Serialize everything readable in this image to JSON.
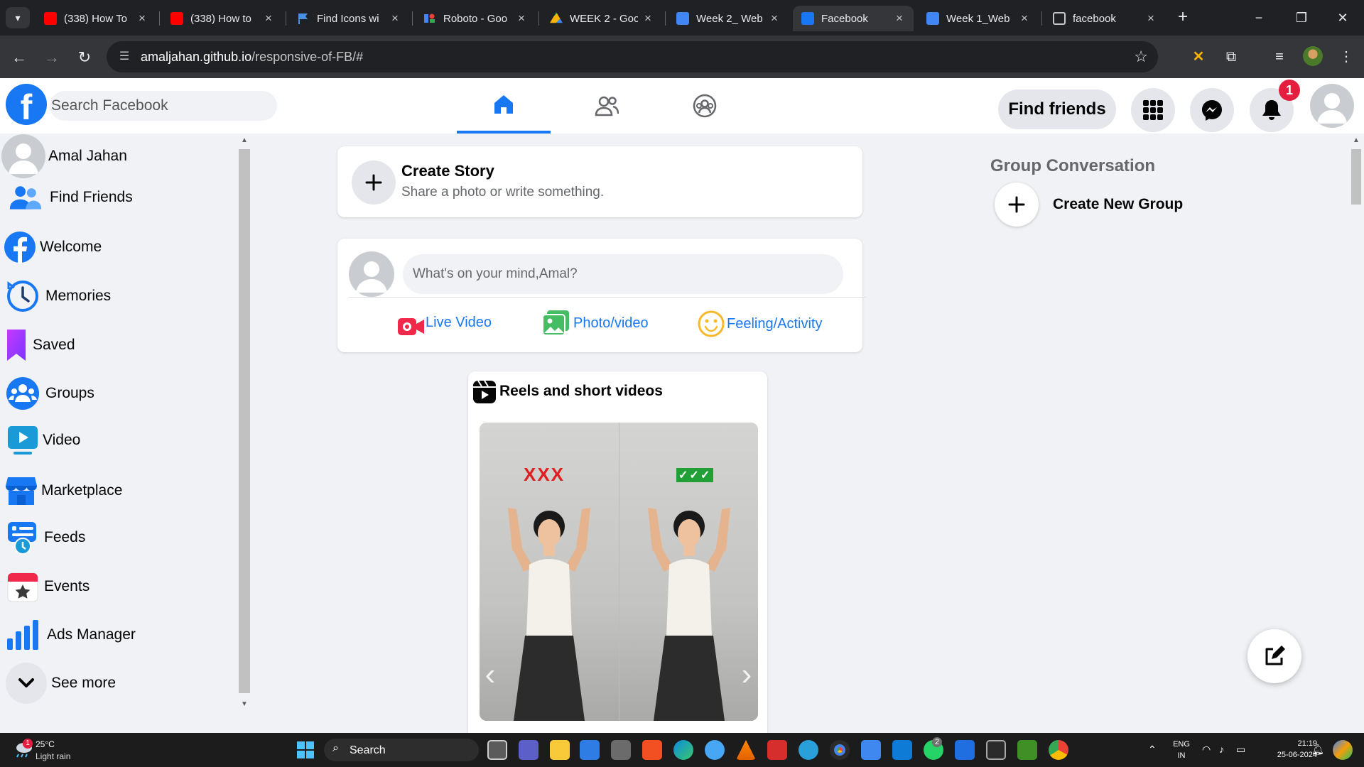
{
  "browser": {
    "tabs": [
      {
        "title": "(338) How To",
        "favicon": "youtube-icon"
      },
      {
        "title": "(338) How to",
        "favicon": "youtube-icon"
      },
      {
        "title": "Find Icons wi",
        "favicon": "flag-icon"
      },
      {
        "title": "Roboto - Goo",
        "favicon": "google-fonts-icon"
      },
      {
        "title": "WEEK 2 - Goo",
        "favicon": "google-drive-icon"
      },
      {
        "title": "Week 2_ Web",
        "favicon": "google-docs-icon"
      },
      {
        "title": "Facebook",
        "favicon": "facebook-icon",
        "active": true
      },
      {
        "title": "Week 1_Web",
        "favicon": "google-docs-icon"
      },
      {
        "title": "facebook",
        "favicon": "globe-icon"
      }
    ],
    "url_host": "amaljahan.github.io",
    "url_path": "/responsive-of-FB/#"
  },
  "header": {
    "logo_letter": "f",
    "search_placeholder": "Search Facebook",
    "find_friends_label": "Find friends",
    "notification_count": "1",
    "accent_color": "#1877f2"
  },
  "sidebar": {
    "items": [
      {
        "label": "Amal Jahan",
        "icon": "user-avatar-icon"
      },
      {
        "label": "Find Friends",
        "icon": "friends-icon"
      },
      {
        "label": "Welcome",
        "icon": "facebook-icon"
      },
      {
        "label": "Memories",
        "icon": "clock-icon"
      },
      {
        "label": "Saved",
        "icon": "bookmark-icon"
      },
      {
        "label": "Groups",
        "icon": "groups-icon"
      },
      {
        "label": "Video",
        "icon": "video-icon"
      },
      {
        "label": "Marketplace",
        "icon": "shop-icon"
      },
      {
        "label": "Feeds",
        "icon": "feeds-icon"
      },
      {
        "label": "Events",
        "icon": "calendar-icon"
      },
      {
        "label": "Ads Manager",
        "icon": "bar-chart-icon"
      },
      {
        "label": "See more",
        "icon": "chevron-down-icon"
      }
    ]
  },
  "story": {
    "title": "Create Story",
    "subtitle": "Share a photo or write something."
  },
  "composer": {
    "placeholder": "What's on your mind,Amal?",
    "actions": [
      {
        "label": "Live Video",
        "icon": "live-video-icon"
      },
      {
        "label": "Photo/video",
        "icon": "photo-icon"
      },
      {
        "label": "Feeling/Activity",
        "icon": "smiley-icon"
      }
    ]
  },
  "reels": {
    "title": "Reels and short videos",
    "left_marks": "XXX",
    "right_marks": "✓✓✓"
  },
  "right_column": {
    "heading": "Group Conversation",
    "create_group_label": "Create New Group"
  },
  "taskbar": {
    "weather_temp": "25°C",
    "weather_condition": "Light rain",
    "weather_badge": "1",
    "search_label": "Search",
    "language_top": "ENG",
    "language_bottom": "IN",
    "time": "21:19",
    "date": "25-06-2024",
    "whatsapp_badge": "2"
  }
}
